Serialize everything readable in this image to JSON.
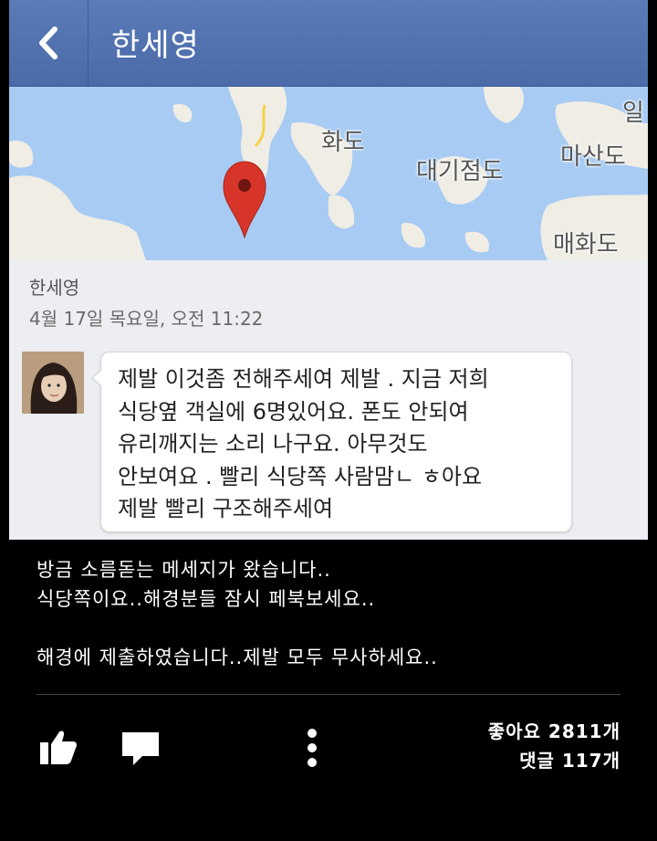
{
  "header": {
    "title": "한세영"
  },
  "map": {
    "labels": [
      "화도",
      "대기점도",
      "마산도",
      "매화도",
      "일"
    ]
  },
  "post": {
    "author": "한세영",
    "timestamp": "4월 17일 목요일, 오전 11:22",
    "message_lines": [
      "제발 이것좀 전해주세여 제발 . 지금 저희",
      "식당옆  객실에 6명있어요. 폰도 안되여",
      "유리깨지는 소리 나구요. 아무것도",
      "안보여요 . 빨리 식당쪽 사람맘ㄴ ㅎ아요",
      "제발 빨리 구조해주세여"
    ]
  },
  "caption": {
    "lines": [
      "방금 소름돋는 메세지가 왔습니다..",
      "식당쪽이요..해경분들 잠시 페북보세요..",
      "",
      "해경에 제출하였습니다..제발 모두 무사하세요.."
    ]
  },
  "footer": {
    "likes": "좋아요 2811개",
    "comments": "댓글 117개"
  },
  "colors": {
    "header_bg": "#4a6aa8",
    "map_water": "#a7cbf3",
    "map_land": "#f0ede5",
    "pin": "#d8352a"
  },
  "icons": [
    "back-arrow-icon",
    "map-pin-icon",
    "like-icon",
    "comment-icon",
    "more-icon"
  ]
}
